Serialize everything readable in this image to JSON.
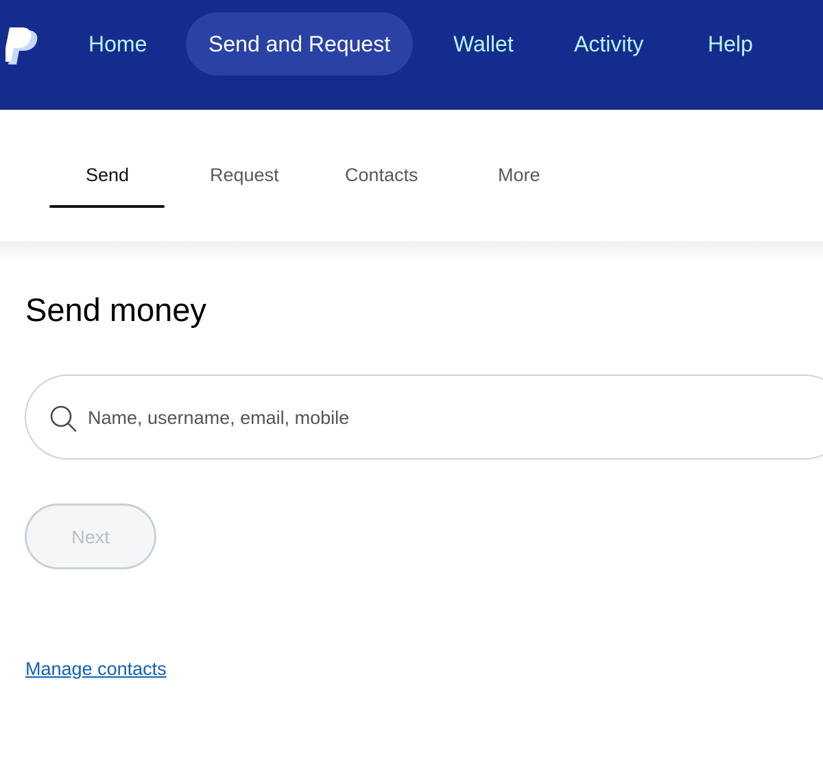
{
  "header": {
    "logo_icon": "paypal-logo",
    "nav": [
      {
        "label": "Home",
        "active": false
      },
      {
        "label": "Send and Request",
        "active": true
      },
      {
        "label": "Wallet",
        "active": false
      },
      {
        "label": "Activity",
        "active": false
      },
      {
        "label": "Help",
        "active": false
      }
    ],
    "colors": {
      "bar": "#142c8e",
      "active_pill": "#2a42a6",
      "text": "#b9f4ff"
    }
  },
  "subnav": {
    "tabs": [
      {
        "label": "Send",
        "active": true
      },
      {
        "label": "Request",
        "active": false
      },
      {
        "label": "Contacts",
        "active": false
      },
      {
        "label": "More",
        "active": false
      }
    ]
  },
  "main": {
    "title": "Send money",
    "search": {
      "icon": "search-icon",
      "placeholder": "Name, username, email, mobile",
      "value": ""
    },
    "next_label": "Next",
    "next_disabled": true,
    "manage_contacts_label": "Manage contacts",
    "link_color": "#0f62b3"
  }
}
